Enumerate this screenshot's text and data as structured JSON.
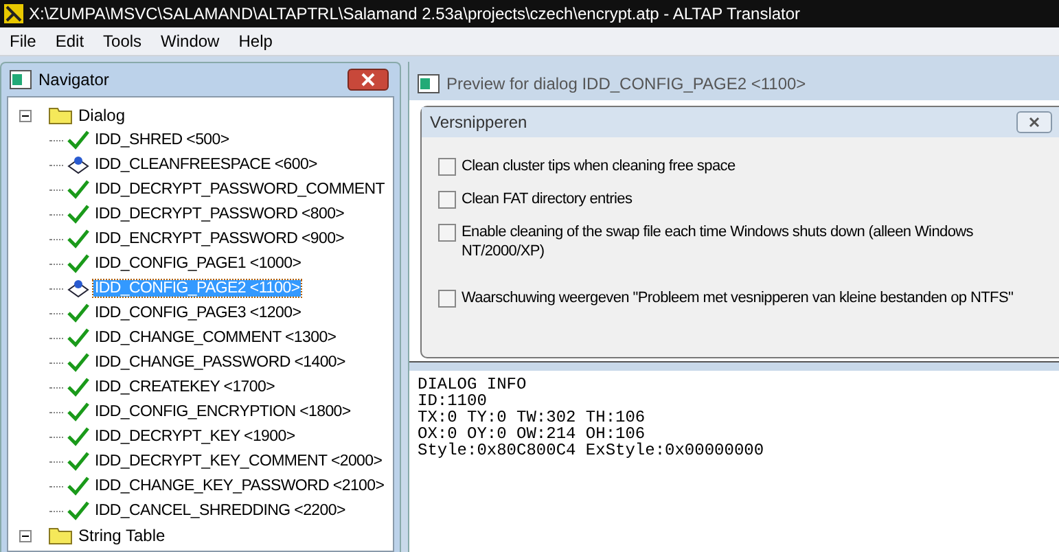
{
  "window": {
    "title": "X:\\ZUMPA\\MSVC\\SALAMAND\\ALTAPTRL\\Salamand 2.53a\\projects\\czech\\encrypt.atp - ALTAP Translator"
  },
  "menu": [
    "File",
    "Edit",
    "Tools",
    "Window",
    "Help"
  ],
  "navigator": {
    "title": "Navigator",
    "tree": [
      {
        "label": "Dialog",
        "expanded": true,
        "children": [
          {
            "label": "IDD_SHRED <500>",
            "kind": "check",
            "selected": false
          },
          {
            "label": "IDD_CLEANFREESPACE <600>",
            "kind": "dialog",
            "selected": false
          },
          {
            "label": "IDD_DECRYPT_PASSWORD_COMMENT",
            "kind": "check",
            "selected": false
          },
          {
            "label": "IDD_DECRYPT_PASSWORD <800>",
            "kind": "check",
            "selected": false
          },
          {
            "label": "IDD_ENCRYPT_PASSWORD <900>",
            "kind": "check",
            "selected": false
          },
          {
            "label": "IDD_CONFIG_PAGE1 <1000>",
            "kind": "check",
            "selected": false
          },
          {
            "label": "IDD_CONFIG_PAGE2 <1100>",
            "kind": "dialog",
            "selected": true
          },
          {
            "label": "IDD_CONFIG_PAGE3 <1200>",
            "kind": "check",
            "selected": false
          },
          {
            "label": "IDD_CHANGE_COMMENT <1300>",
            "kind": "check",
            "selected": false
          },
          {
            "label": "IDD_CHANGE_PASSWORD <1400>",
            "kind": "check",
            "selected": false
          },
          {
            "label": "IDD_CREATEKEY <1700>",
            "kind": "check",
            "selected": false
          },
          {
            "label": "IDD_CONFIG_ENCRYPTION <1800>",
            "kind": "check",
            "selected": false
          },
          {
            "label": "IDD_DECRYPT_KEY <1900>",
            "kind": "check",
            "selected": false
          },
          {
            "label": "IDD_DECRYPT_KEY_COMMENT <2000>",
            "kind": "check",
            "selected": false
          },
          {
            "label": "IDD_CHANGE_KEY_PASSWORD <2100>",
            "kind": "check",
            "selected": false
          },
          {
            "label": "IDD_CANCEL_SHREDDING <2200>",
            "kind": "check",
            "selected": false
          }
        ]
      },
      {
        "label": "String Table",
        "expanded": true
      }
    ]
  },
  "preview": {
    "title": "Preview for dialog IDD_CONFIG_PAGE2 <1100>",
    "dialog": {
      "title": "Versnipperen",
      "options": [
        {
          "label": "Clean cluster tips when cleaning free space",
          "checked": false
        },
        {
          "label": "Clean FAT directory entries",
          "checked": false
        },
        {
          "label": "Enable cleaning of the swap file each time Windows shuts down (alleen Windows NT/2000/XP)",
          "checked": false
        },
        {
          "label": "Waarschuwing weergeven \"Probleem met vesnipperen van kleine bestanden op NTFS\"",
          "checked": false
        }
      ]
    }
  },
  "info": [
    "DIALOG INFO",
    "ID:1100",
    "TX:0 TY:0 TW:302 TH:106",
    "OX:0 OY:0 OW:214 OH:106",
    "Style:0x80C800C4 ExStyle:0x00000000"
  ]
}
